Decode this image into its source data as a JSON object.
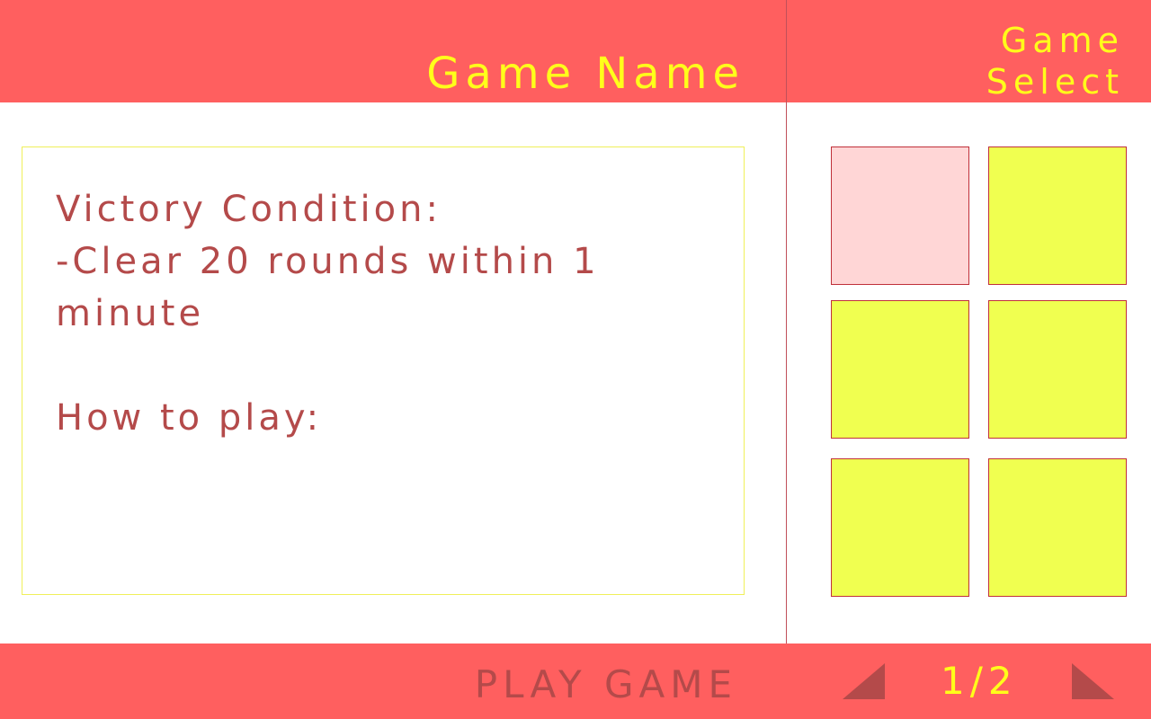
{
  "header": {
    "game_name": "Game Name",
    "game_select": "Game\nSelect"
  },
  "description": {
    "victory_heading": "Victory Condition:",
    "victory_line": "-Clear 20 rounds within 1 minute",
    "howto_heading": "How to play:"
  },
  "footer": {
    "play_label": "PLAY GAME",
    "page_indicator": "1/2",
    "prev_icon": "triangle-left-icon",
    "next_icon": "triangle-right-icon"
  },
  "tiles": {
    "count": 6,
    "selected_index": 0
  },
  "colors": {
    "bar": "#ff5f5f",
    "accent_yellow": "#ffff1a",
    "text_dark_red": "#b44a4a",
    "tile_yellow": "#f0ff50",
    "tile_selected": "#ffd6d6"
  }
}
